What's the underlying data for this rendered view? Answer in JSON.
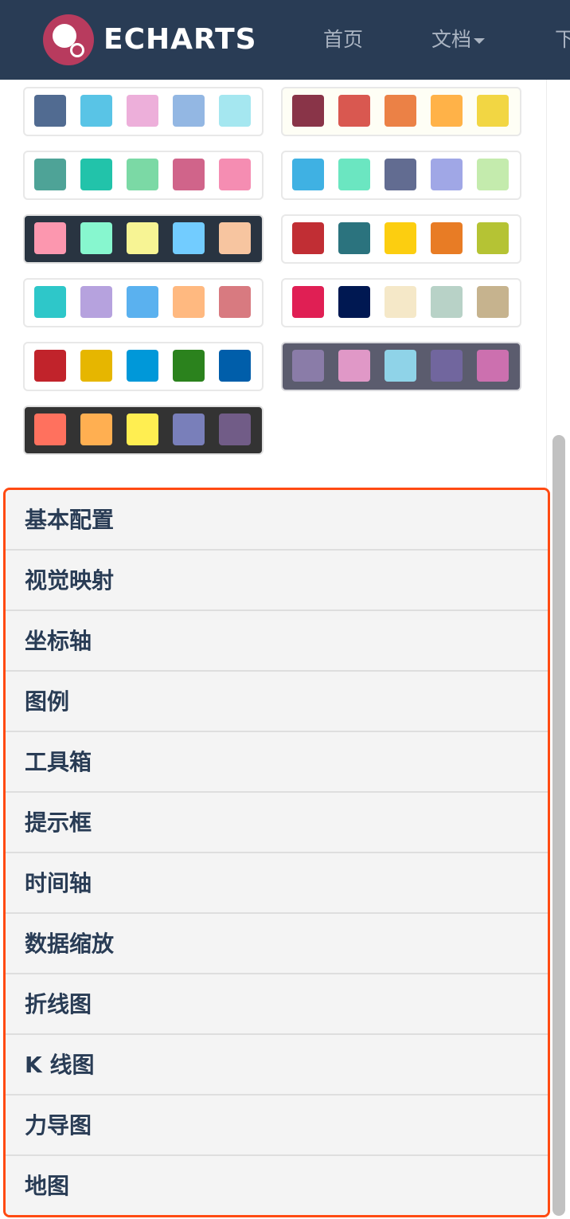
{
  "header": {
    "brand": "ECHARTS",
    "nav": [
      {
        "label": "首页"
      },
      {
        "label": "文档"
      },
      {
        "label": "下"
      }
    ]
  },
  "themes": [
    {
      "bg": "#ffffff",
      "colors": [
        "#516b91",
        "#59c4e6",
        "#edafda",
        "#93b7e3",
        "#a5e7f0"
      ]
    },
    {
      "bg": "#fefef5",
      "colors": [
        "#893448",
        "#d95850",
        "#eb8146",
        "#ffb248",
        "#f2d643"
      ]
    },
    {
      "bg": "#ffffff",
      "colors": [
        "#4ea397",
        "#22c3aa",
        "#7bd9a5",
        "#d0648a",
        "#f58db2"
      ]
    },
    {
      "bg": "#ffffff",
      "colors": [
        "#3fb1e3",
        "#6be6c1",
        "#626c91",
        "#a0a7e6",
        "#c4ebad"
      ]
    },
    {
      "bg": "#293441",
      "colors": [
        "#fc97af",
        "#87f7cf",
        "#f7f494",
        "#72ccff",
        "#f7c5a0"
      ]
    },
    {
      "bg": "#ffffff",
      "colors": [
        "#c12e34",
        "#2b737e",
        "#fcce10",
        "#e87c25",
        "#b5c334"
      ]
    },
    {
      "bg": "#ffffff",
      "colors": [
        "#2ec7c9",
        "#b6a2de",
        "#5ab1ef",
        "#ffb980",
        "#d87a80"
      ]
    },
    {
      "bg": "#ffffff",
      "colors": [
        "#e01f54",
        "#001852",
        "#f5e8c8",
        "#b8d2c7",
        "#c6b38e"
      ]
    },
    {
      "bg": "#ffffff",
      "colors": [
        "#c1232b",
        "#e6b600",
        "#0098d9",
        "#2b821d",
        "#005eaa"
      ]
    },
    {
      "bg": "#5b5c6e",
      "colors": [
        "#8a7ca8",
        "#e098c7",
        "#8fd3e8",
        "#71669e",
        "#cc70af"
      ]
    },
    {
      "bg": "#333333",
      "colors": [
        "#ff715e",
        "#ffaf51",
        "#ffee51",
        "#797fba",
        "#715c87"
      ]
    }
  ],
  "menu": [
    {
      "label": "基本配置"
    },
    {
      "label": "视觉映射"
    },
    {
      "label": "坐标轴"
    },
    {
      "label": "图例"
    },
    {
      "label": "工具箱"
    },
    {
      "label": "提示框"
    },
    {
      "label": "时间轴"
    },
    {
      "label": "数据缩放"
    },
    {
      "label": "折线图"
    },
    {
      "label": "K 线图"
    },
    {
      "label": "力导图"
    },
    {
      "label": "地图"
    }
  ]
}
